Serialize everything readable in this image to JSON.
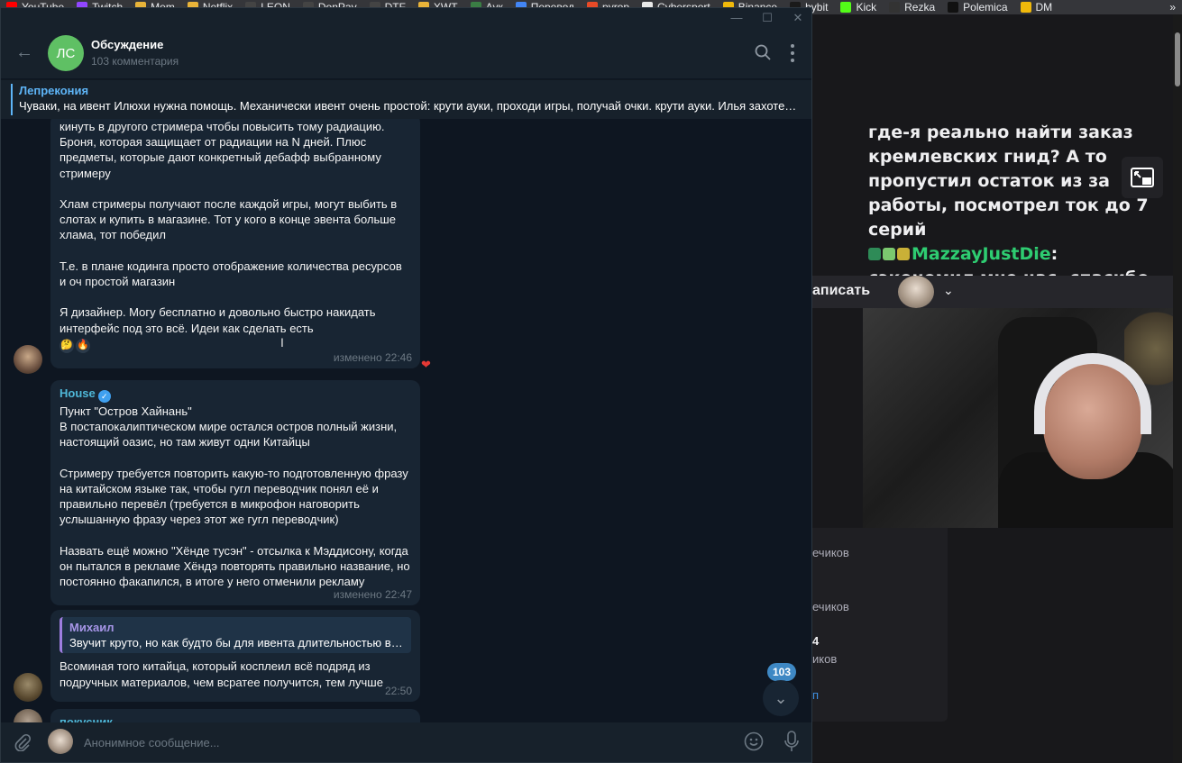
{
  "browser": {
    "bookmarks": [
      {
        "label": "YouTube",
        "icon": "youtube-icon",
        "color": "#ff0000"
      },
      {
        "label": "Twitch",
        "icon": "twitch-icon",
        "color": "#9146ff"
      },
      {
        "label": "Mem",
        "icon": "folder-icon",
        "color": "#e8b339"
      },
      {
        "label": "Netflix",
        "icon": "folder-icon",
        "color": "#e8b339"
      },
      {
        "label": "LEON",
        "icon": "leon-icon",
        "color": "#444444"
      },
      {
        "label": "DonPay",
        "icon": "donpay-icon",
        "color": "#444444"
      },
      {
        "label": "DTF",
        "icon": "dtf-icon",
        "color": "#444444"
      },
      {
        "label": "XWT",
        "icon": "xwt-icon",
        "color": "#e8b339"
      },
      {
        "label": "Аук",
        "icon": "auk-icon",
        "color": "#3a7d44"
      },
      {
        "label": "Перевод",
        "icon": "translate-icon",
        "color": "#4285f4"
      },
      {
        "label": "pyrop",
        "icon": "pyrop-icon",
        "color": "#e84a27"
      },
      {
        "label": "Cybersport",
        "icon": "cybersport-icon",
        "color": "#e8e8e8"
      },
      {
        "label": "Binance",
        "icon": "binance-icon",
        "color": "#f0b90b"
      },
      {
        "label": "bybit",
        "icon": "bybit-icon",
        "color": "#1a1a1a"
      },
      {
        "label": "Kick",
        "icon": "kick-icon",
        "color": "#53fc18"
      },
      {
        "label": "Rezka",
        "icon": "rezka-icon",
        "color": "#333333"
      },
      {
        "label": "Polemica",
        "icon": "polemica-icon",
        "color": "#111111"
      },
      {
        "label": "DM",
        "icon": "dm-icon",
        "color": "#f0b90b"
      }
    ],
    "more": "»"
  },
  "stream": {
    "chat_line1": "где-я реально найти заказ кремлевских гнид? А то пропустил остаток из за работы, посмотрел ток до 7 серий",
    "chat_user": "MazzayJustDie",
    "chat_line2": ": сэкономил мне час, спасибо",
    "toolbar_label": "аписать",
    "side": {
      "line1": "ечиков",
      "line2": "ечиков",
      "line3": "4",
      "line4": "иков",
      "link": "п"
    }
  },
  "telegram": {
    "title": "Обсуждение",
    "subtitle": "103 комментария",
    "avatar_initials": "ЛС",
    "colors": {
      "accent": "#5eb5f7",
      "bg": "#0e1621",
      "bubble": "#182533"
    },
    "pinned": {
      "name": "Лепрекония",
      "text": "Чуваки, на ивент Илюхи нужна помощь. Механически ивент очень простой: крути ауки, проходи игры, получай очки. крути ауки. Илья захоте…"
    },
    "messages": [
      {
        "text": "кинуть в другого стримера чтобы повысить тому радиацию. Броня, которая защищает от радиации на N дней. Плюс предметы, которые дают конкретный дебафф выбранному стримеру\n\nХлам стримеры получают после каждой игры, могут выбить в слотах и купить в магазине. Тот у кого в конце эвента больше хлама, тот победил\n\nТ.е. в плане кодинга просто отображение количества ресурсов и оч простой магазин\n\nЯ дизайнер. Могу бесплатно и довольно быстро накидать интерфейс под это всё. Идеи как сделать есть",
        "meta": "изменено 22:46",
        "reactions": [
          "🤔",
          "🔥"
        ]
      },
      {
        "sender": "House",
        "sender_color": "#4fb8d8",
        "text": "Пункт \"Остров Хайнань\"\nВ постапокалиптическом мире остался остров полный жизни, настоящий оазис, но там живут одни Китайцы\n\nСтримеру требуется повторить какую-то подготовленную фразу на китайском языке так, чтобы гугл переводчик понял её и правильно перевёл (требуется в микрофон наговорить услышанную фразу через этот же гугл переводчик)\n\nНазвать ещё можно \"Хёнде тусэн\" - отсылка к Мэддисону, когда он пытался в рекламе Хёндэ повторять правильно название, но постоянно факапился, в итоге у него отменили рекламу",
        "meta": "изменено 22:47"
      },
      {
        "reply_name": "Михаил",
        "reply_text": "Звучит круто, но как будто бы для ивента длительностью в 1…",
        "text": "Всоминая того китайца, который косплеил всё подряд из подручных материалов, чем всратее получится, тем лучше",
        "meta": "22:50"
      },
      {
        "sender": "покусник",
        "sender_color": "#4fb8d8"
      }
    ],
    "unread_count": "103",
    "composer_placeholder": "Анонимное сообщение..."
  }
}
